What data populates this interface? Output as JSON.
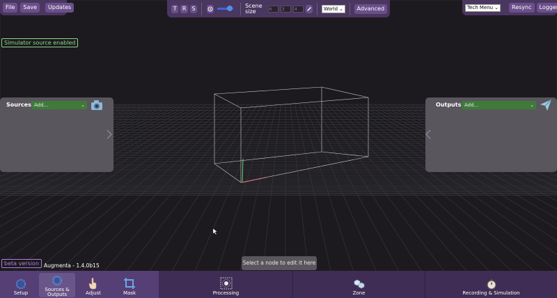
{
  "left_toolbar": {
    "file": "File",
    "save": "Save",
    "updates": "Updates"
  },
  "center_toolbar": {
    "t": "T",
    "r": "R",
    "s": "S",
    "slider_value": 0.7,
    "scene_size_label": "Scene\nsize",
    "size_fields": [
      "6",
      "3",
      "4"
    ],
    "space_select": "World",
    "advanced": "Advanced"
  },
  "right_toolbar": {
    "tech_menu": "Tech Menu",
    "status_color": "#7ed38a",
    "resync": "Resync",
    "logger": "Logger"
  },
  "simulator_badge": "Simulator source enabled",
  "sources": {
    "title": "Sources",
    "select": "Add..."
  },
  "outputs": {
    "title": "Outputs",
    "select": "Add..."
  },
  "tooltip": "Select a node to edit it here",
  "beta_badge": "beta version",
  "version": "Augmenta - 1.4.0b15",
  "bottom_tabs": {
    "setup": "Setup",
    "sources_outputs": "Sources &\nOutputs",
    "adjust": "Adjust",
    "mask": "Mask",
    "processing": "Processing",
    "zone": "Zone",
    "recording": "Recording & Simulation"
  },
  "colors": {
    "accent": "#6a4f8a",
    "toolbar_bg": "#4a3760",
    "green_select": "#3f7a3a",
    "badge_green": "#8ad88a",
    "badge_purple": "#b07ee0"
  }
}
